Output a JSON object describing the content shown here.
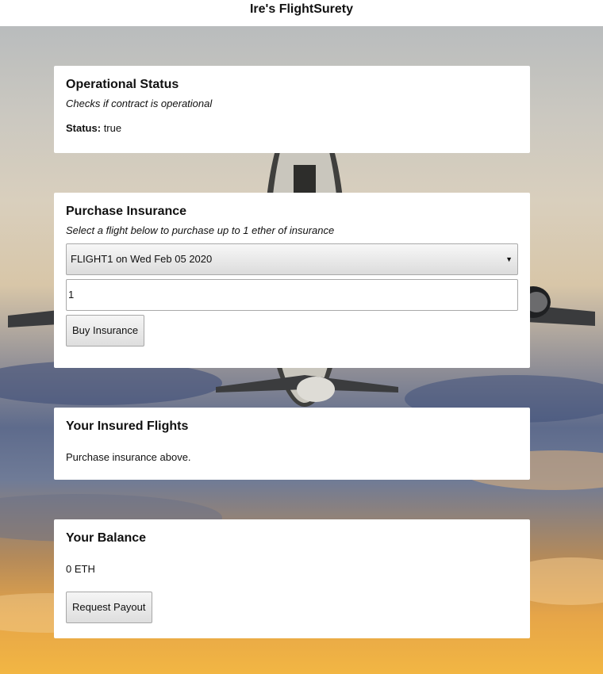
{
  "app": {
    "title": "Ire's FlightSurety"
  },
  "operational": {
    "heading": "Operational Status",
    "subtitle": "Checks if contract is operational",
    "status_label": "Status:",
    "status_value": "true"
  },
  "purchase": {
    "heading": "Purchase Insurance",
    "subtitle": "Select a flight below to purchase up to 1 ether of insurance",
    "selected_flight": "FLIGHT1 on Wed Feb 05 2020",
    "amount_value": "1",
    "buy_label": "Buy Insurance"
  },
  "insured": {
    "heading": "Your Insured Flights",
    "empty_text": "Purchase insurance above."
  },
  "balance": {
    "heading": "Your Balance",
    "value": "0 ETH",
    "payout_label": "Request Payout"
  },
  "icons": {
    "select_caret": "chevron-down-icon"
  }
}
